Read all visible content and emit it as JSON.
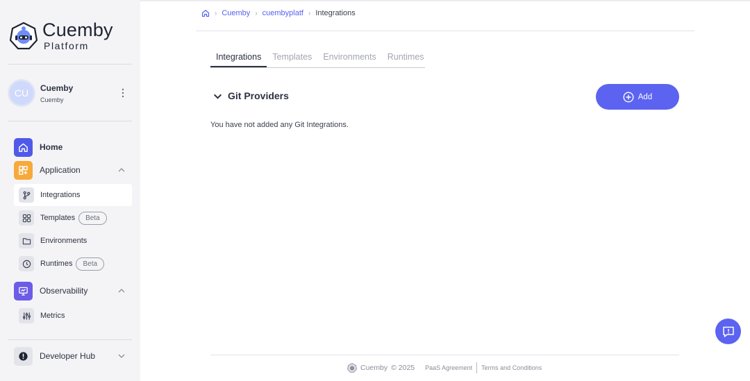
{
  "brand": {
    "title": "Cuemby",
    "subtitle": "Platform"
  },
  "user": {
    "initials": "CU",
    "name": "Cuemby",
    "org": "Cuemby"
  },
  "nav": {
    "home": "Home",
    "application": "Application",
    "integrations": "Integrations",
    "templates": "Templates",
    "templates_badge": "Beta",
    "environments": "Environments",
    "runtimes": "Runtimes",
    "runtimes_badge": "Beta",
    "observability": "Observability",
    "metrics": "Metrics",
    "developer_hub": "Developer Hub"
  },
  "breadcrumb": {
    "org": "Cuemby",
    "project": "cuembyplatf",
    "current": "Integrations"
  },
  "tabs": [
    "Integrations",
    "Templates",
    "Environments",
    "Runtimes"
  ],
  "section": {
    "title": "Git Providers",
    "add_label": "Add",
    "empty_message": "You have not added any Git Integrations."
  },
  "footer": {
    "brand": "Cuemby",
    "copyright": "© 2025",
    "paas": "PaaS Agreement",
    "terms": "Terms and Conditions"
  },
  "colors": {
    "accent": "#5b63f0",
    "application": "#f7a93a",
    "observability": "#6c5ce7",
    "sidebar_bg": "#f4f4f6"
  },
  "icons": [
    "home-icon",
    "apps-icon",
    "git-branch-icon",
    "grid-icon",
    "folder-icon",
    "clock-icon",
    "monitor-icon",
    "sliders-icon",
    "alert-icon",
    "chevron-up-icon",
    "chevron-down-icon",
    "plus-circle-icon",
    "chat-help-icon"
  ]
}
